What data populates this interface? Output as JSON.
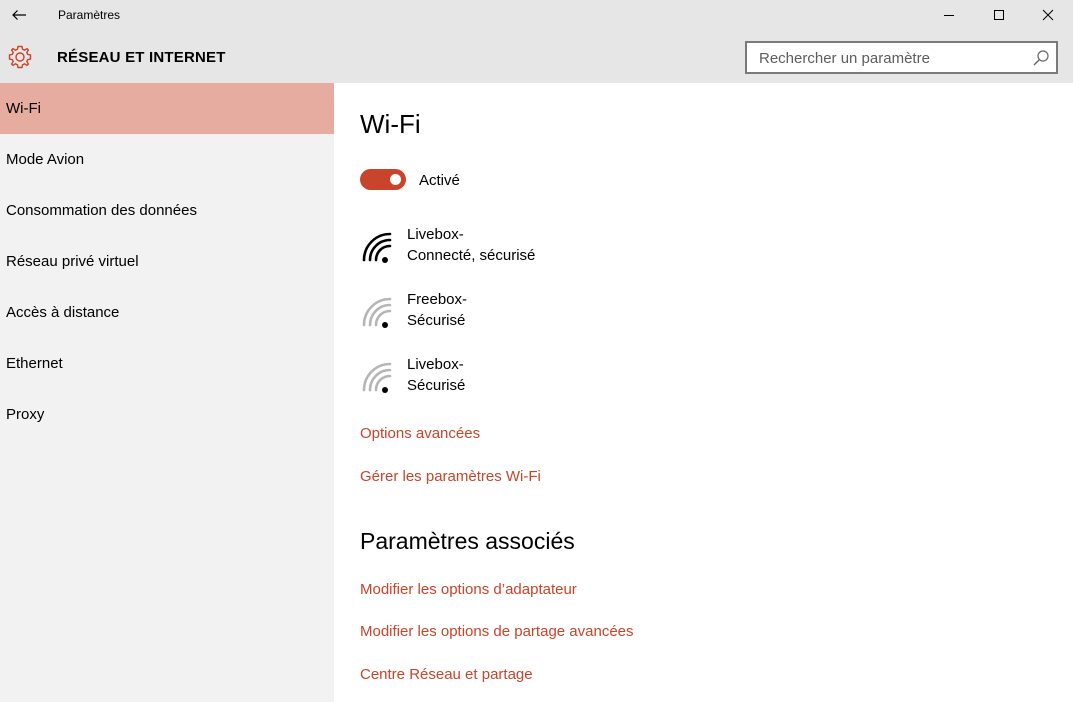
{
  "window": {
    "title": "Paramètres"
  },
  "header": {
    "section_title": "RÉSEAU ET INTERNET",
    "search_placeholder": "Rechercher un paramètre"
  },
  "sidebar": {
    "items": [
      {
        "label": "Wi-Fi",
        "active": true
      },
      {
        "label": "Mode Avion"
      },
      {
        "label": "Consommation des données"
      },
      {
        "label": "Réseau privé virtuel"
      },
      {
        "label": "Accès à distance"
      },
      {
        "label": "Ethernet"
      },
      {
        "label": "Proxy"
      }
    ]
  },
  "main": {
    "title": "Wi-Fi",
    "toggle": {
      "label": "Activé",
      "on": true
    },
    "networks": [
      {
        "name": "Livebox-",
        "status": "Connecté, sécurisé",
        "icon": "wifi-strong-icon"
      },
      {
        "name": "Freebox-",
        "status": "Sécurisé",
        "icon": "wifi-weak-icon"
      },
      {
        "name": "Livebox-",
        "status": "Sécurisé",
        "icon": "wifi-weak-icon"
      }
    ],
    "links": {
      "advanced": "Options avancées",
      "manage": "Gérer les paramètres Wi-Fi"
    },
    "related": {
      "title": "Paramètres associés",
      "links": [
        "Modifier les options d’adaptateur",
        "Modifier les options de partage avancées",
        "Centre Réseau et partage"
      ]
    }
  },
  "colors": {
    "accent": "#c8442a",
    "sidebar_active": "#e6aca0",
    "chrome": "#e6e6e6",
    "sidebar_bg": "#f2f2f2"
  }
}
